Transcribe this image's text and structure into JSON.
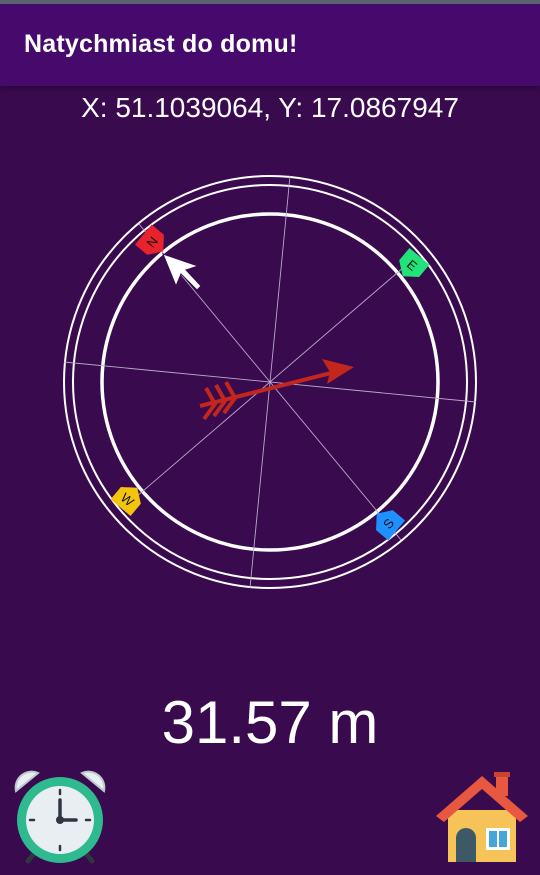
{
  "app": {
    "title": "Natychmiast do domu!"
  },
  "location": {
    "coordinates_text": "X: 51.1039064, Y: 17.0867947"
  },
  "compass": {
    "markers": {
      "north": "N",
      "east": "E",
      "south": "S",
      "west": "W"
    },
    "colors": {
      "north": "#e8232b",
      "east": "#22e37a",
      "south": "#1e90ff",
      "west": "#f2c40c",
      "home_arrow": "#c3261d",
      "ring": "#ffffff"
    },
    "icons": {
      "north_pointer": "cursor-arrow-icon",
      "home_direction": "red-arrow-icon"
    }
  },
  "distance": {
    "text": "31.57 m"
  },
  "buttons": {
    "alarm_icon": "alarm-clock-icon",
    "home_icon": "house-icon"
  },
  "theme": {
    "background": "#3a0a4f",
    "toolbar": "#450a6b"
  }
}
